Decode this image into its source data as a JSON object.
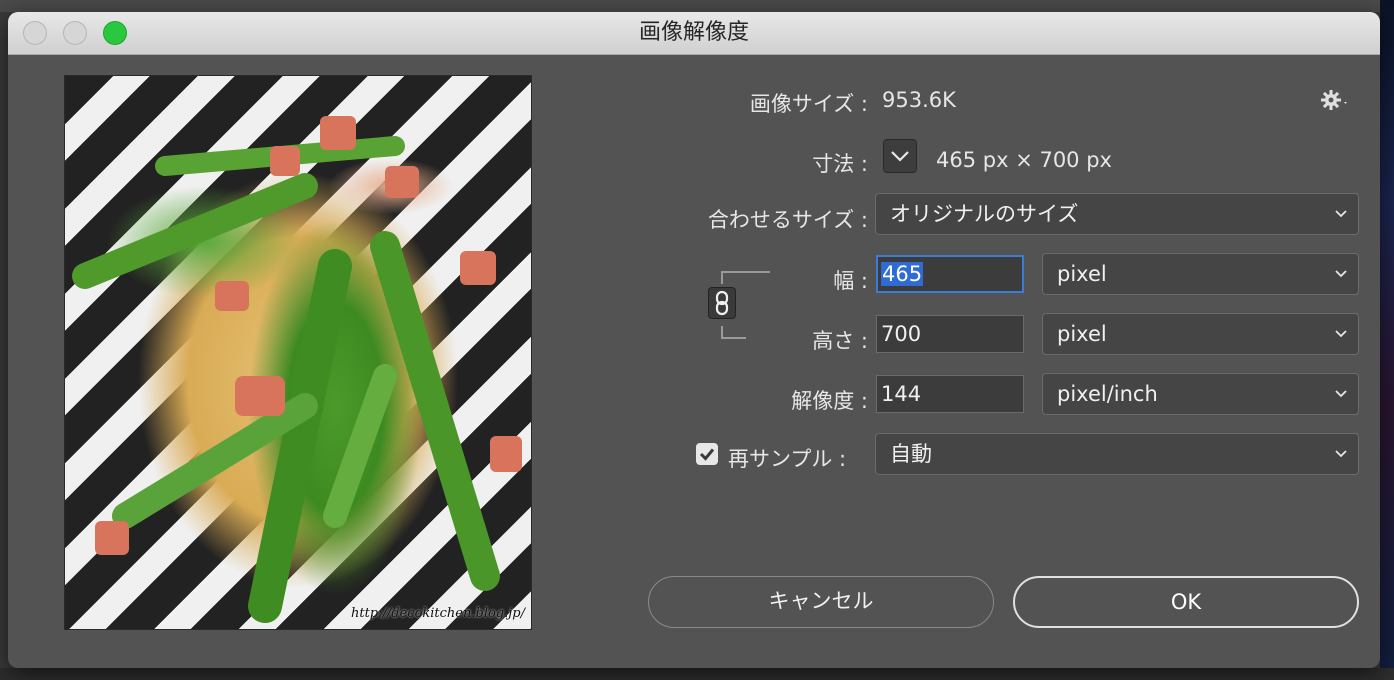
{
  "window": {
    "title": "画像解像度"
  },
  "image_size": {
    "label": "画像サイズ :",
    "value": "953.6K"
  },
  "dimensions": {
    "label": "寸法 :",
    "value": "465 px × 700 px"
  },
  "fit_to": {
    "label": "合わせるサイズ :",
    "selected": "オリジナルのサイズ"
  },
  "width": {
    "label": "幅 :",
    "value": "465",
    "unit": "pixel"
  },
  "height": {
    "label": "高さ :",
    "value": "700",
    "unit": "pixel"
  },
  "resolution": {
    "label": "解像度 :",
    "value": "144",
    "unit": "pixel/inch"
  },
  "resample": {
    "label": "再サンプル :",
    "checked": true,
    "selected": "自動"
  },
  "preview": {
    "watermark": "http://decokitchen.blog.jp/"
  },
  "buttons": {
    "cancel": "キャンセル",
    "ok": "OK"
  },
  "colors": {
    "accent": "#3b7cd4",
    "zoom": "#2ac840",
    "panel": "#535353"
  },
  "icons": [
    "gear-icon",
    "chevron-down-icon",
    "chain-link-icon",
    "checkmark-icon"
  ]
}
